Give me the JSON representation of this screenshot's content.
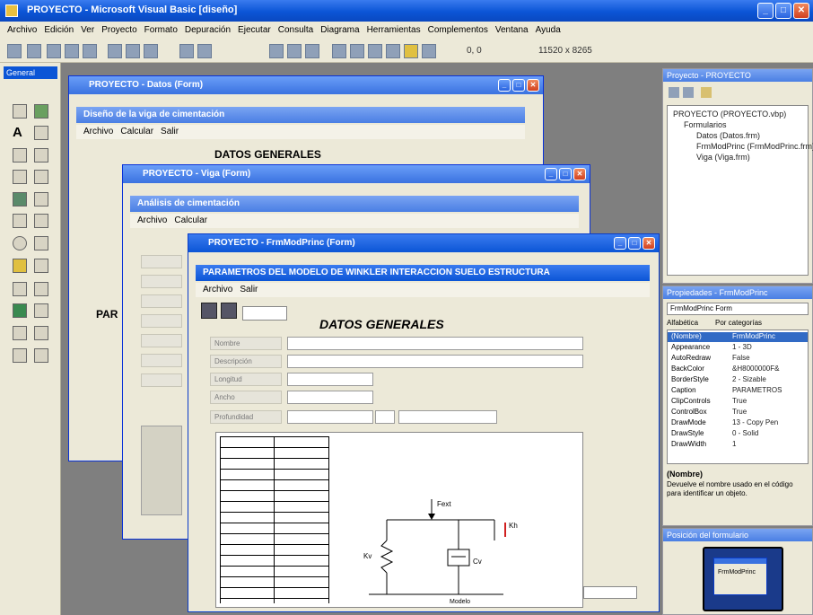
{
  "app": {
    "title": "PROYECTO - Microsoft Visual Basic [diseño]"
  },
  "menubar": [
    "Archivo",
    "Edición",
    "Ver",
    "Proyecto",
    "Formato",
    "Depuración",
    "Ejecutar",
    "Consulta",
    "Diagrama",
    "Herramientas",
    "Complementos",
    "Ventana",
    "Ayuda"
  ],
  "toolbar": {
    "position_readout": "0, 0",
    "size_readout": "11520 x 8265"
  },
  "toolbox": {
    "title": "General"
  },
  "windows": {
    "back": {
      "title": "PROYECTO - Datos (Form)",
      "inner_title": "Diseño de la viga de cimentación",
      "menu": [
        "Archivo",
        "Calcular",
        "Salir"
      ],
      "heading": "DATOS GENERALES",
      "side_text": "PAR"
    },
    "middle": {
      "title": "PROYECTO - Viga (Form)",
      "inner_title": "Análisis de cimentación",
      "menu": [
        "Archivo",
        "Calcular"
      ]
    },
    "front": {
      "title": "PROYECTO - FrmModPrinc (Form)",
      "inner_title": "PARAMETROS DEL MODELO DE WINKLER INTERACCION SUELO ESTRUCTURA",
      "menu": [
        "Archivo",
        "Salir"
      ],
      "heading": "DATOS GENERALES",
      "fields": [
        "Nombre",
        "Descripción",
        "Longitud",
        "Ancho",
        "Profundidad"
      ]
    }
  },
  "explorer": {
    "title": "Proyecto - PROYECTO",
    "root": "PROYECTO (PROYECTO.vbp)",
    "folder": "Formularios",
    "items": [
      "Datos (Datos.frm)",
      "FrmModPrinc (FrmModPrinc.frm)",
      "Viga (Viga.frm)"
    ]
  },
  "properties": {
    "title": "Propiedades - FrmModPrinc",
    "object": "FrmModPrinc Form",
    "tabs": [
      "Alfabética",
      "Por categorías"
    ],
    "rows": [
      [
        "(Nombre)",
        "FrmModPrinc"
      ],
      [
        "Appearance",
        "1 - 3D"
      ],
      [
        "AutoRedraw",
        "False"
      ],
      [
        "BackColor",
        "&H8000000F&"
      ],
      [
        "BorderStyle",
        "2 - Sizable"
      ],
      [
        "Caption",
        "PARAMETROS"
      ],
      [
        "ClipControls",
        "True"
      ],
      [
        "ControlBox",
        "True"
      ],
      [
        "DrawMode",
        "13 - Copy Pen"
      ],
      [
        "DrawStyle",
        "0 - Solid"
      ],
      [
        "DrawWidth",
        "1"
      ]
    ],
    "desc_title": "(Nombre)",
    "desc_text": "Devuelve el nombre usado en el código para identificar un objeto."
  },
  "layout_panel": {
    "title": "Posición del formulario",
    "form_label": "FrmModPrinc"
  },
  "diagram": {
    "label_top": "Fext",
    "label_spring": "Kv",
    "label_damper": "Cv",
    "label_right": "Kh",
    "caption": "Modelo"
  }
}
